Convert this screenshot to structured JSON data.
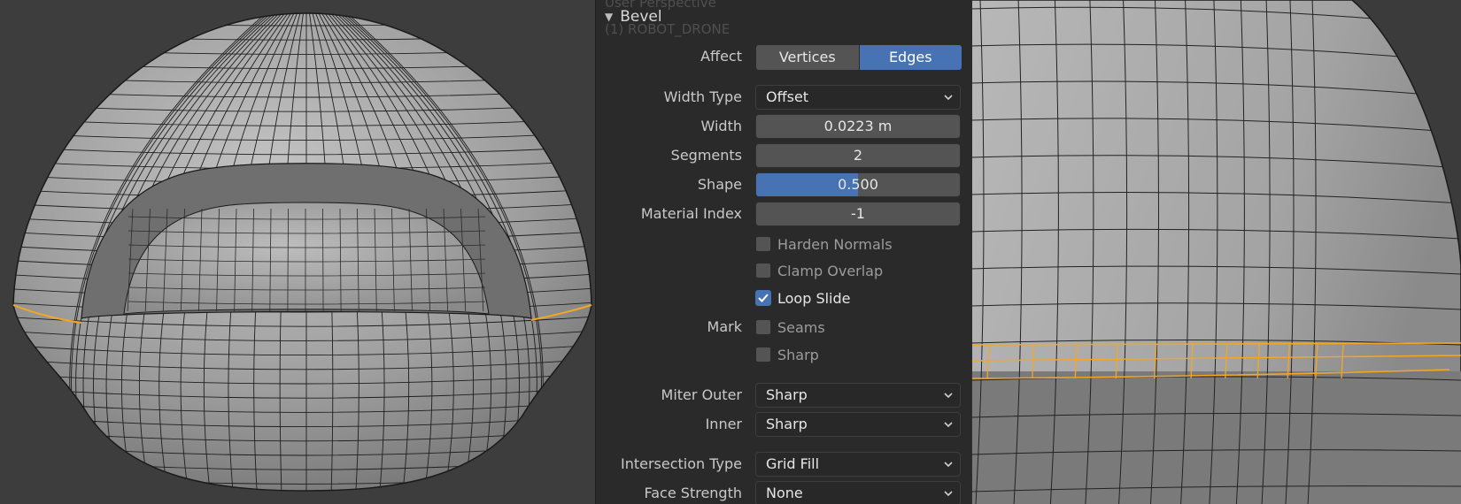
{
  "viewport": {
    "overlay_line1": "User Perspective",
    "overlay_line2": "(1) ROBOT_DRONE"
  },
  "panel": {
    "title": "Bevel",
    "affect": {
      "label": "Affect",
      "options": [
        "Vertices",
        "Edges"
      ],
      "selected": "Edges"
    },
    "width_type": {
      "label": "Width Type",
      "value": "Offset"
    },
    "width": {
      "label": "Width",
      "value": "0.0223 m"
    },
    "segments": {
      "label": "Segments",
      "value": "2"
    },
    "shape": {
      "label": "Shape",
      "value": "0.500",
      "fraction": 0.5
    },
    "material_index": {
      "label": "Material Index",
      "value": "-1"
    },
    "harden_normals": {
      "label": "Harden Normals",
      "checked": false
    },
    "clamp_overlap": {
      "label": "Clamp Overlap",
      "checked": false
    },
    "loop_slide": {
      "label": "Loop Slide",
      "checked": true
    },
    "mark": {
      "label": "Mark",
      "seams": {
        "label": "Seams",
        "checked": false
      },
      "sharp": {
        "label": "Sharp",
        "checked": false
      }
    },
    "miter_outer": {
      "label": "Miter Outer",
      "value": "Sharp"
    },
    "miter_inner": {
      "label": "Inner",
      "value": "Sharp"
    },
    "intersection_type": {
      "label": "Intersection Type",
      "value": "Grid Fill"
    },
    "face_strength": {
      "label": "Face Strength",
      "value": "None"
    }
  },
  "colors": {
    "accent": "#4772b3",
    "selected_edge": "#f5a623",
    "mesh_face": "#8e8e8e",
    "viewport_bg": "#3d3d3d"
  }
}
